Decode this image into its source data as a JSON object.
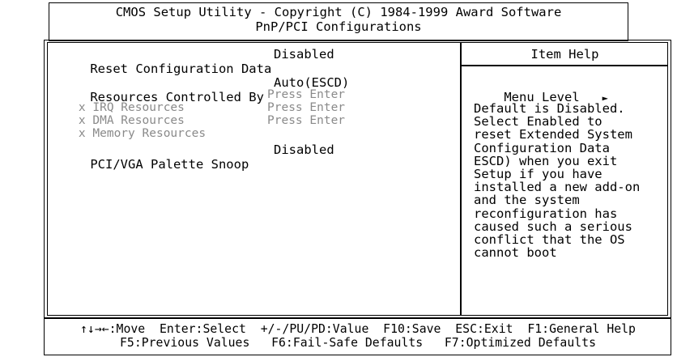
{
  "header": {
    "line1": "CMOS Setup Utility - Copyright (C) 1984-1999 Award Software",
    "line2": "PnP/PCI Configurations"
  },
  "settings": [
    {
      "label": "Reset Configuration Data",
      "value": "Disabled",
      "disabled": false,
      "prefix": ""
    },
    {
      "label": "Resources Controlled By",
      "value": "Auto(ESCD)",
      "disabled": false,
      "prefix": ""
    },
    {
      "label": "IRQ Resources",
      "value": "Press Enter",
      "disabled": true,
      "prefix": "x"
    },
    {
      "label": "DMA Resources",
      "value": "Press Enter",
      "disabled": true,
      "prefix": "x"
    },
    {
      "label": "Memory Resources",
      "value": "Press Enter",
      "disabled": true,
      "prefix": "x"
    },
    {
      "label": "PCI/VGA Palette Snoop",
      "value": "Disabled",
      "disabled": false,
      "prefix": ""
    }
  ],
  "help": {
    "title": "Item Help",
    "menu_level": "Menu Level",
    "menu_level_arrow": "►",
    "lines": [
      "Default is Disabled.",
      "Select Enabled to",
      "reset Extended System",
      "Configuration Data",
      "ESCD) when you exit",
      "Setup if you have",
      "installed a new add-on",
      "and the system",
      "reconfiguration has",
      "caused such a serious",
      "conflict that the OS",
      "cannot boot"
    ]
  },
  "footer": {
    "line1": "↑↓→←:Move  Enter:Select  +/-/PU/PD:Value  F10:Save  ESC:Exit  F1:General Help",
    "line2": "F5:Previous Values   F6:Fail-Safe Defaults   F7:Optimized Defaults"
  }
}
